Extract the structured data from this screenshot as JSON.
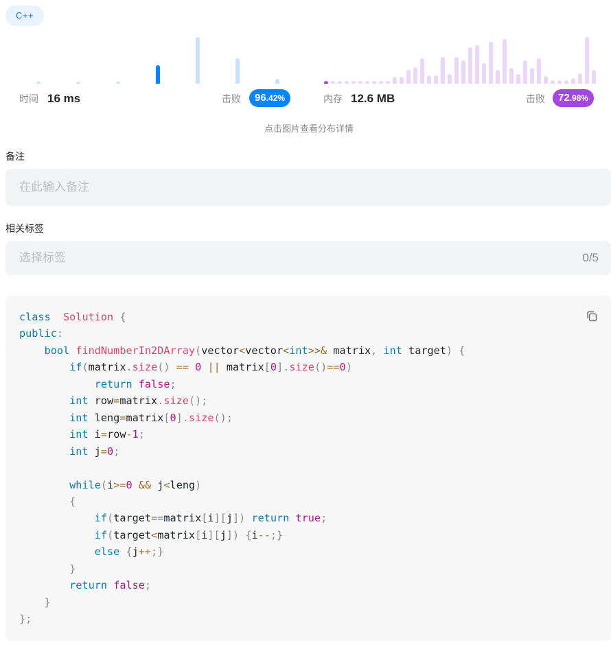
{
  "language_tag": "C++",
  "runtime": {
    "label": "时间",
    "value": "16 ms",
    "beat_label": "击败",
    "beat_int": "96",
    "beat_dec": ".42%",
    "color": "#0a84ff",
    "bar_color_light": "#c9e1fb",
    "bar_color_active": "#0a84ff",
    "distribution": [
      {
        "level": 0.05,
        "active": false
      },
      {
        "level": 0.05,
        "active": false
      },
      {
        "level": 0.05,
        "active": false
      },
      {
        "level": 0.4,
        "active": true
      },
      {
        "level": 1.0,
        "active": false
      },
      {
        "level": 0.55,
        "active": false
      },
      {
        "level": 0.1,
        "active": false
      }
    ]
  },
  "memory": {
    "label": "内存",
    "value": "12.6 MB",
    "beat_label": "击败",
    "beat_int": "72",
    "beat_dec": ".98%",
    "color": "#a347e0",
    "bar_color_light": "#ead6f7",
    "bar_color_active": "#a347e0",
    "distribution": [
      {
        "level": 0.06,
        "active": true
      },
      {
        "level": 0.06,
        "active": false
      },
      {
        "level": 0.06,
        "active": false
      },
      {
        "level": 0.06,
        "active": false
      },
      {
        "level": 0.06,
        "active": false
      },
      {
        "level": 0.06,
        "active": false
      },
      {
        "level": 0.06,
        "active": false
      },
      {
        "level": 0.06,
        "active": false
      },
      {
        "level": 0.06,
        "active": false
      },
      {
        "level": 0.06,
        "active": false
      },
      {
        "level": 0.14,
        "active": false
      },
      {
        "level": 0.14,
        "active": false
      },
      {
        "level": 0.3,
        "active": false
      },
      {
        "level": 0.36,
        "active": false
      },
      {
        "level": 0.55,
        "active": false
      },
      {
        "level": 0.18,
        "active": false
      },
      {
        "level": 0.18,
        "active": false
      },
      {
        "level": 0.58,
        "active": false
      },
      {
        "level": 0.2,
        "active": false
      },
      {
        "level": 0.58,
        "active": false
      },
      {
        "level": 0.5,
        "active": false
      },
      {
        "level": 0.78,
        "active": false
      },
      {
        "level": 0.82,
        "active": false
      },
      {
        "level": 0.44,
        "active": false
      },
      {
        "level": 0.9,
        "active": false
      },
      {
        "level": 0.3,
        "active": false
      },
      {
        "level": 0.95,
        "active": false
      },
      {
        "level": 0.34,
        "active": false
      },
      {
        "level": 0.2,
        "active": false
      },
      {
        "level": 0.5,
        "active": false
      },
      {
        "level": 0.34,
        "active": false
      },
      {
        "level": 0.55,
        "active": false
      },
      {
        "level": 0.16,
        "active": false
      },
      {
        "level": 0.08,
        "active": false
      },
      {
        "level": 0.08,
        "active": false
      },
      {
        "level": 0.08,
        "active": false
      },
      {
        "level": 0.12,
        "active": false
      },
      {
        "level": 0.22,
        "active": false
      },
      {
        "level": 1.0,
        "active": false
      },
      {
        "level": 0.3,
        "active": false
      }
    ]
  },
  "hint": "点击图片查看分布详情",
  "notes": {
    "label": "备注",
    "placeholder": "在此输入备注"
  },
  "tags": {
    "label": "相关标签",
    "placeholder": "选择标签",
    "counter": "0/5"
  },
  "code_lines": [
    [
      [
        "kw",
        "class"
      ],
      [
        "",
        "  "
      ],
      [
        "cls",
        "Solution"
      ],
      [
        "",
        ""
      ],
      [
        "pn",
        " {"
      ]
    ],
    [
      [
        "kw",
        "public"
      ],
      [
        "pn",
        ":"
      ]
    ],
    [
      [
        "",
        "    "
      ],
      [
        "ty",
        "bool"
      ],
      [
        "",
        " "
      ],
      [
        "fn",
        "findNumberIn2DArray"
      ],
      [
        "pn",
        "("
      ],
      [
        "",
        "vector"
      ],
      [
        "op",
        "<"
      ],
      [
        "",
        "vector"
      ],
      [
        "op",
        "<"
      ],
      [
        "ty",
        "int"
      ],
      [
        "op",
        ">>&"
      ],
      [
        "",
        " matrix"
      ],
      [
        "pn",
        ","
      ],
      [
        "",
        " "
      ],
      [
        "ty",
        "int"
      ],
      [
        "",
        " target"
      ],
      [
        "pn",
        ")"
      ],
      [
        "pn",
        " {"
      ]
    ],
    [
      [
        "",
        "        "
      ],
      [
        "kw",
        "if"
      ],
      [
        "pn",
        "("
      ],
      [
        "",
        "matrix"
      ],
      [
        "pn",
        "."
      ],
      [
        "fn",
        "size"
      ],
      [
        "pn",
        "()"
      ],
      [
        "",
        " "
      ],
      [
        "op",
        "=="
      ],
      [
        "",
        " "
      ],
      [
        "num",
        "0"
      ],
      [
        "",
        " "
      ],
      [
        "op",
        "||"
      ],
      [
        "",
        " matrix"
      ],
      [
        "pn",
        "["
      ],
      [
        "num",
        "0"
      ],
      [
        "pn",
        "]."
      ],
      [
        "fn",
        "size"
      ],
      [
        "pn",
        "()"
      ],
      [
        "op",
        "=="
      ],
      [
        "num",
        "0"
      ],
      [
        "pn",
        ")"
      ]
    ],
    [
      [
        "",
        "            "
      ],
      [
        "kw",
        "return"
      ],
      [
        "",
        " "
      ],
      [
        "bool",
        "false"
      ],
      [
        "pn",
        ";"
      ]
    ],
    [
      [
        "",
        "        "
      ],
      [
        "ty",
        "int"
      ],
      [
        "",
        " row"
      ],
      [
        "op",
        "="
      ],
      [
        "",
        "matrix"
      ],
      [
        "pn",
        "."
      ],
      [
        "fn",
        "size"
      ],
      [
        "pn",
        "();"
      ]
    ],
    [
      [
        "",
        "        "
      ],
      [
        "ty",
        "int"
      ],
      [
        "",
        " leng"
      ],
      [
        "op",
        "="
      ],
      [
        "",
        "matrix"
      ],
      [
        "pn",
        "["
      ],
      [
        "num",
        "0"
      ],
      [
        "pn",
        "]."
      ],
      [
        "fn",
        "size"
      ],
      [
        "pn",
        "();"
      ]
    ],
    [
      [
        "",
        "        "
      ],
      [
        "ty",
        "int"
      ],
      [
        "",
        " i"
      ],
      [
        "op",
        "="
      ],
      [
        "",
        "row"
      ],
      [
        "op",
        "-"
      ],
      [
        "num",
        "1"
      ],
      [
        "pn",
        ";"
      ]
    ],
    [
      [
        "",
        "        "
      ],
      [
        "ty",
        "int"
      ],
      [
        "",
        " j"
      ],
      [
        "op",
        "="
      ],
      [
        "num",
        "0"
      ],
      [
        "pn",
        ";"
      ]
    ],
    [
      [
        "",
        ""
      ]
    ],
    [
      [
        "",
        "        "
      ],
      [
        "kw",
        "while"
      ],
      [
        "pn",
        "("
      ],
      [
        "",
        "i"
      ],
      [
        "op",
        ">="
      ],
      [
        "num",
        "0"
      ],
      [
        "",
        " "
      ],
      [
        "op",
        "&&"
      ],
      [
        "",
        " j"
      ],
      [
        "op",
        "<"
      ],
      [
        "",
        "leng"
      ],
      [
        "pn",
        ")"
      ]
    ],
    [
      [
        "",
        "        "
      ],
      [
        "pn",
        "{"
      ]
    ],
    [
      [
        "",
        "            "
      ],
      [
        "kw",
        "if"
      ],
      [
        "pn",
        "("
      ],
      [
        "",
        "target"
      ],
      [
        "op",
        "=="
      ],
      [
        "",
        "matrix"
      ],
      [
        "pn",
        "["
      ],
      [
        "",
        "i"
      ],
      [
        "pn",
        "]["
      ],
      [
        "",
        "j"
      ],
      [
        "pn",
        "])"
      ],
      [
        "",
        " "
      ],
      [
        "kw",
        "return"
      ],
      [
        "",
        " "
      ],
      [
        "bool",
        "true"
      ],
      [
        "pn",
        ";"
      ]
    ],
    [
      [
        "",
        "            "
      ],
      [
        "kw",
        "if"
      ],
      [
        "pn",
        "("
      ],
      [
        "",
        "target"
      ],
      [
        "op",
        "<"
      ],
      [
        "",
        "matrix"
      ],
      [
        "pn",
        "["
      ],
      [
        "",
        "i"
      ],
      [
        "pn",
        "]["
      ],
      [
        "",
        "j"
      ],
      [
        "pn",
        "])"
      ],
      [
        "",
        " "
      ],
      [
        "pn",
        "{"
      ],
      [
        "",
        "i"
      ],
      [
        "op",
        "--"
      ],
      [
        "pn",
        ";}"
      ]
    ],
    [
      [
        "",
        "            "
      ],
      [
        "kw",
        "else"
      ],
      [
        "",
        " "
      ],
      [
        "pn",
        "{"
      ],
      [
        "",
        "j"
      ],
      [
        "op",
        "++"
      ],
      [
        "pn",
        ";}"
      ]
    ],
    [
      [
        "",
        "        "
      ],
      [
        "pn",
        "}"
      ]
    ],
    [
      [
        "",
        "        "
      ],
      [
        "kw",
        "return"
      ],
      [
        "",
        " "
      ],
      [
        "bool",
        "false"
      ],
      [
        "pn",
        ";"
      ]
    ],
    [
      [
        "",
        "    "
      ],
      [
        "pn",
        "}"
      ]
    ],
    [
      [
        "pn",
        "};"
      ]
    ]
  ]
}
